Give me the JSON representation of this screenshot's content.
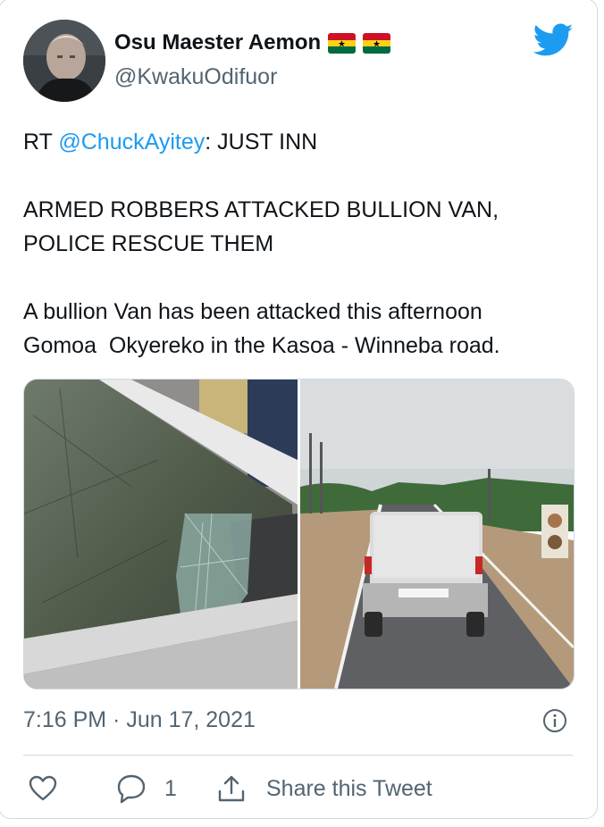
{
  "tweet": {
    "display_name": "Osu Maester Aemon",
    "handle": "@KwakuOdifuor",
    "flags": [
      "ghana-flag",
      "ghana-flag"
    ],
    "retweet_prefix": "RT ",
    "retweet_mention": "@ChuckAyitey",
    "retweet_after_mention": ": JUST INN",
    "headline_line1": "ARMED ROBBERS ATTACKED BULLION VAN,",
    "headline_line2": "POLICE RESCUE THEM",
    "body_line1": "A bullion Van has been attacked this afternoon",
    "body_line2": "Gomoa  Okyereko in the Kasoa - Winneba road.",
    "timestamp": "7:16 PM · Jun 17, 2021",
    "reply_count": "1",
    "share_label": "Share this Tweet"
  },
  "media": [
    {
      "icon": "shattered-window-photo"
    },
    {
      "icon": "white-van-on-road-photo"
    }
  ],
  "colors": {
    "accent": "#1d9bf0",
    "text": "#0f1419",
    "secondary": "#536471",
    "border": "#cfd9de",
    "ghana_red": "#ce1126",
    "ghana_gold": "#fcd116",
    "ghana_green": "#006b3f"
  },
  "icons": {
    "brand": "twitter-bird-icon",
    "info": "info-icon",
    "like": "heart-icon",
    "reply": "reply-bubble-icon",
    "share": "share-icon"
  }
}
